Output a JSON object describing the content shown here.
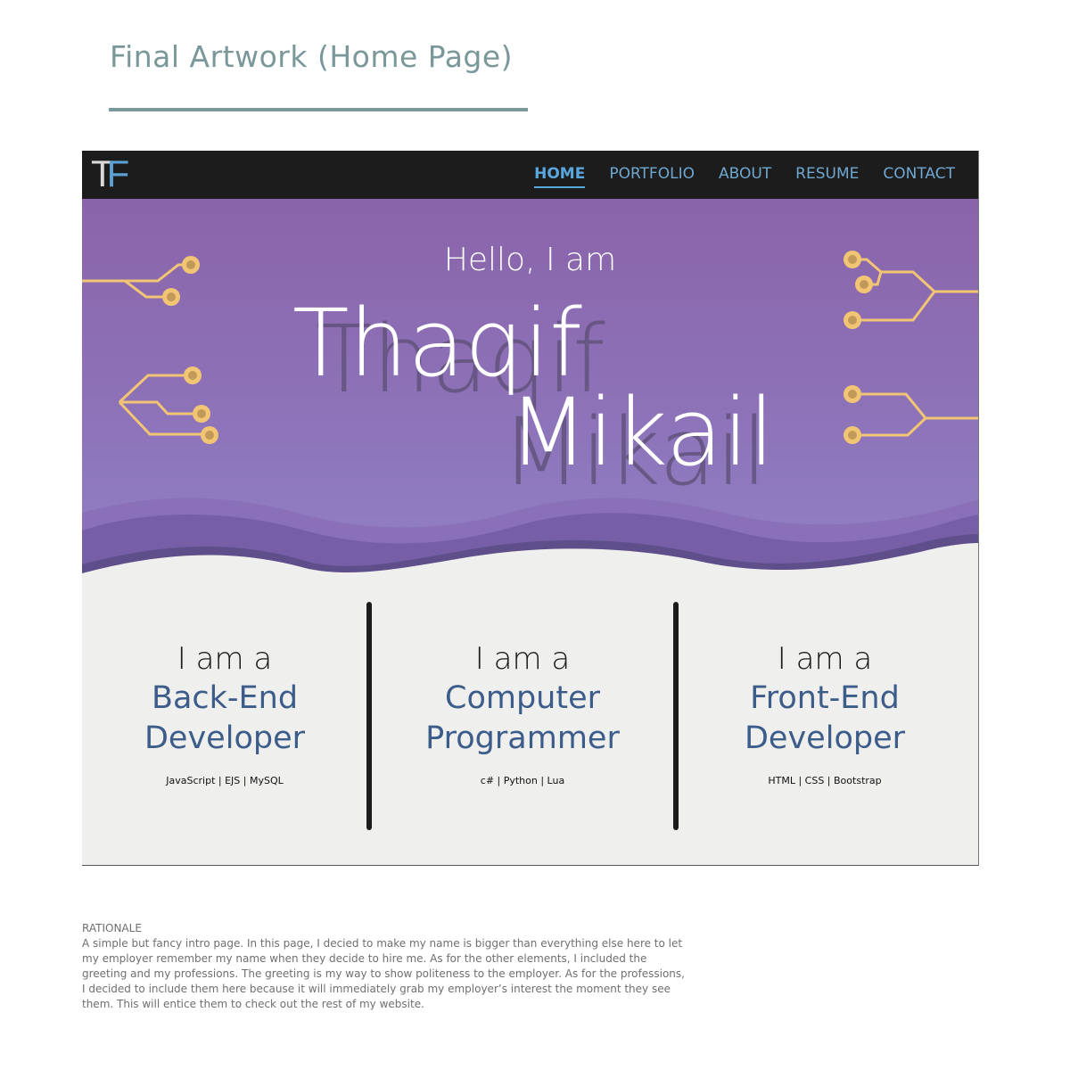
{
  "page": {
    "heading": "Final Artwork (Home Page)"
  },
  "navbar": {
    "logo": {
      "t": "T",
      "f": "F"
    },
    "items": [
      {
        "label": "HOME",
        "active": true
      },
      {
        "label": "PORTFOLIO",
        "active": false
      },
      {
        "label": "ABOUT",
        "active": false
      },
      {
        "label": "RESUME",
        "active": false
      },
      {
        "label": "CONTACT",
        "active": false
      }
    ]
  },
  "hero": {
    "greeting": "Hello, I am",
    "first_name": "Thaqif",
    "last_name": "Mikail"
  },
  "roles": [
    {
      "prefix": "I am a",
      "line1": "Back-End",
      "line2": "Developer",
      "stack": "JavaScript | EJS | MySQL"
    },
    {
      "prefix": "I am a",
      "line1": "Computer",
      "line2": "Programmer",
      "stack": "c# | Python | Lua"
    },
    {
      "prefix": "I am a",
      "line1": "Front-End",
      "line2": "Developer",
      "stack": "HTML | CSS | Bootstrap"
    }
  ],
  "rationale": {
    "title": "RATIONALE",
    "text": "A simple but fancy intro page. In this page, I decied to make my name is bigger than everything else here to let my employer remember my name when they decide to hire me. As for the other elements, I included the greeting and my professions. The greeting is my way to show politeness to the employer. As for the professions, I decided to include them here because it will immediately grab my employer’s interest the moment they see them. This will entice them to check out the rest of my website."
  },
  "colors": {
    "accent_heading": "#7a9799",
    "navbar_bg": "#1d1c1c",
    "nav_link": "#6ea7d0",
    "hero_purple": "#8d72b8",
    "circuit": "#f2c574",
    "role_blue": "#3c5c8a"
  }
}
